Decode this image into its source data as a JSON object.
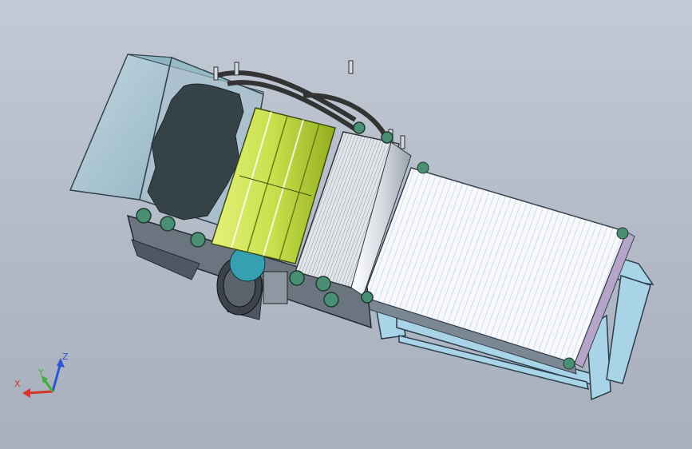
{
  "viewport": {
    "background_top": "#c3cad5",
    "background_bottom": "#a8b0bd"
  },
  "model": {
    "hopper_color": "#a9c7d3",
    "rotor_color": "#c8e04c",
    "conveyor_color": "#f4f6fa",
    "frame_color": "#a9d3e6",
    "belt_color": "#333333",
    "pulley_color": "#4a8f73"
  },
  "triad": {
    "x_label": "X",
    "y_label": "Y",
    "z_label": "Z",
    "x_color": "#d8342c",
    "y_color": "#3fae3a",
    "z_color": "#2f55d4"
  }
}
